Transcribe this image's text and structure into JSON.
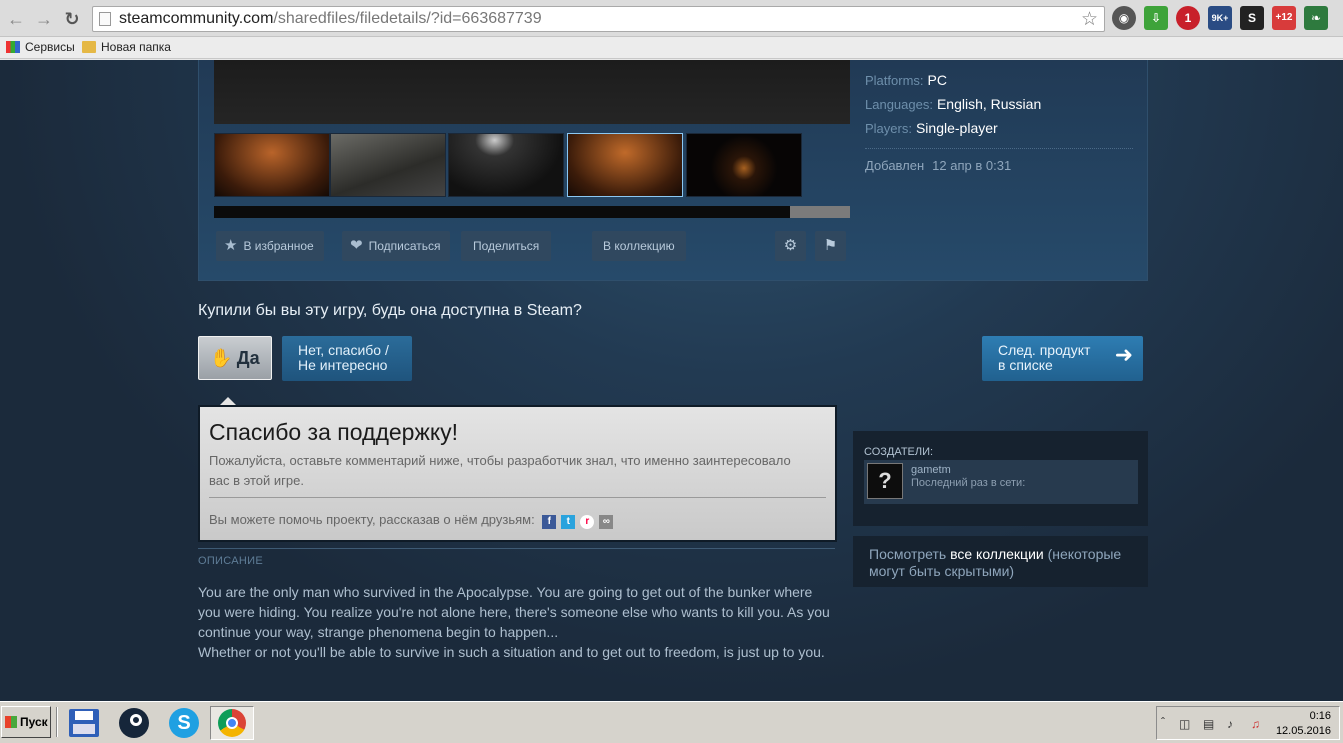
{
  "browser": {
    "url_host": "steamcommunity.com",
    "url_path": "/sharedfiles/filedetails/?id=663687739",
    "bookmarks": [
      "Сервисы",
      "Новая папка"
    ],
    "extensions": [
      {
        "name": "globe-icon",
        "color": "#555555",
        "label": ""
      },
      {
        "name": "download-icon",
        "color": "#3ea33a",
        "label": ""
      },
      {
        "name": "adblock-icon",
        "color": "#c8202a",
        "label": "1"
      },
      {
        "name": "mail-icon",
        "color": "#2a4c84",
        "label": "9K+"
      },
      {
        "name": "s-icon",
        "color": "#222222",
        "label": "S"
      },
      {
        "name": "weather-icon",
        "color": "#d83b3b",
        "label": "+12"
      },
      {
        "name": "sprout-icon",
        "color": "#2e7a3e",
        "label": ""
      }
    ]
  },
  "meta": {
    "platforms_key": "Platforms:",
    "platforms_val": "PC",
    "languages_key": "Languages:",
    "languages_val1": "English",
    "languages_sep": ",",
    "languages_val2": "Russian",
    "players_key": "Players:",
    "players_val": "Single-player",
    "added_key": "Добавлен",
    "added_val": "12 апр в 0:31"
  },
  "actions": {
    "favorite": "В избранное",
    "subscribe": "Подписаться",
    "share": "Поделиться",
    "collection": "В коллекцию"
  },
  "vote": {
    "question": "Купили бы вы эту игру, будь она доступна в Steam?",
    "yes": "Да",
    "no_line1": "Нет, спасибо /",
    "no_line2": "Не интересно",
    "next_line1": "След. продукт",
    "next_line2": "в списке"
  },
  "thanks": {
    "title": "Спасибо за поддержку!",
    "text": "Пожалуйста, оставьте комментарий ниже, чтобы разработчик знал, что именно заинтересовало вас в этой игре.",
    "share": "Вы можете помочь проекту, рассказав о нём друзьям:"
  },
  "description": {
    "label": "ОПИСАНИЕ",
    "para1": "You are the only man who survived in the Apocalypse. You are going to get out of the bunker where you were hiding. You realize you're not alone here, there's someone else who wants to kill you. As you continue your way, strange phenomena begin to happen...",
    "para2": "Whether or not you'll be able to survive in such a situation and to get out to freedom, is just up to you."
  },
  "creators": {
    "label": "СОЗДАТЕЛИ:",
    "name": "gametm",
    "status": "Последний раз в сети:",
    "avatar": "?"
  },
  "collections": {
    "prefix": "Посмотреть ",
    "link": "все коллекции",
    "suffix": " (некоторые могут быть скрытыми)"
  },
  "taskbar": {
    "start": "Пуск",
    "time": "0:16",
    "date": "12.05.2016"
  }
}
